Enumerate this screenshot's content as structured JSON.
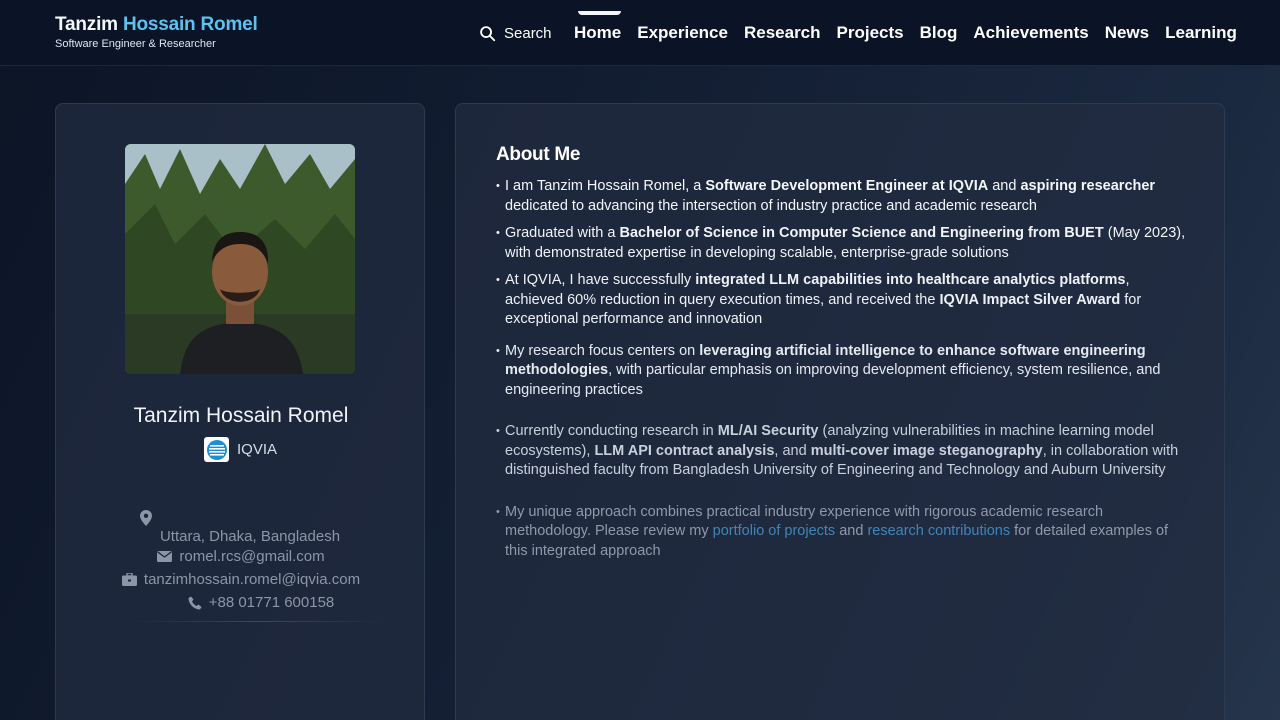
{
  "header": {
    "brand_first": "Tanzim",
    "brand_last": "Hossain Romel",
    "brand_subtitle": "Software Engineer & Researcher",
    "search_label": "Search",
    "search_icon": "search-icon",
    "nav": [
      {
        "label": "Home",
        "active": true
      },
      {
        "label": "Experience"
      },
      {
        "label": "Research"
      },
      {
        "label": "Projects"
      },
      {
        "label": "Blog"
      },
      {
        "label": "Achievements"
      },
      {
        "label": "News"
      },
      {
        "label": "Learning"
      }
    ]
  },
  "profile": {
    "photo": "profile-photo",
    "name": "Tanzim Hossain Romel",
    "company": "IQVIA",
    "company_logo": "iqvia-logo",
    "location": "Uttara, Dhaka, Bangladesh",
    "location_icon": "map-pin-icon",
    "email_personal": "romel.rcs@gmail.com",
    "email_icon": "envelope-icon",
    "email_work": "tanzimhossain.romel@iqvia.com",
    "work_icon": "briefcase-icon",
    "phone": "+88 01771 600158",
    "phone_icon": "phone-icon"
  },
  "about": {
    "title": "About Me",
    "b1": {
      "t1": "I am Tanzim Hossain Romel, a ",
      "s1": "Software Development Engineer at IQVIA",
      "t2": " and ",
      "s2": "aspiring researcher",
      "t3": " dedicated to advancing the intersection of industry practice and academic research"
    },
    "b2": {
      "t1": "Graduated with a ",
      "s1": "Bachelor of Science in Computer Science and Engineering from BUET",
      "t2": " (May 2023), with demonstrated expertise in developing scalable, enterprise-grade solutions"
    },
    "b3": {
      "t1": "At IQVIA, I have successfully ",
      "s1": "integrated LLM capabilities into healthcare analytics platforms",
      "t2": ", achieved 60% reduction in query execution times, and received the ",
      "s2": "IQVIA Impact Silver Award",
      "t3": " for exceptional performance and innovation"
    },
    "b4": {
      "t1": "My research focus centers on ",
      "s1": "leveraging artificial intelligence to enhance software engineering methodologies",
      "t2": ", with particular emphasis on improving development efficiency, system resilience, and engineering practices"
    },
    "b5": {
      "t1": "Currently conducting research in ",
      "s1": "ML/AI Security",
      "t2": " (analyzing vulnerabilities in machine learning model ecosystems), ",
      "s2": "LLM API contract analysis",
      "t3": ", and ",
      "s3": "multi-cover image steganography",
      "t4": ", in collaboration with distinguished faculty from Bangladesh University of Engineering and Technology and Auburn University"
    },
    "b6": {
      "t1": "My unique approach combines practical industry experience with rigorous academic research methodology. Please review my ",
      "link1": "portfolio of projects",
      "t2": " and ",
      "link2": "research contributions",
      "t3": " for detailed examples of this integrated approach"
    }
  },
  "colors": {
    "accent": "#5cc2f0",
    "link": "#3f86b8",
    "background": "#131e33"
  }
}
